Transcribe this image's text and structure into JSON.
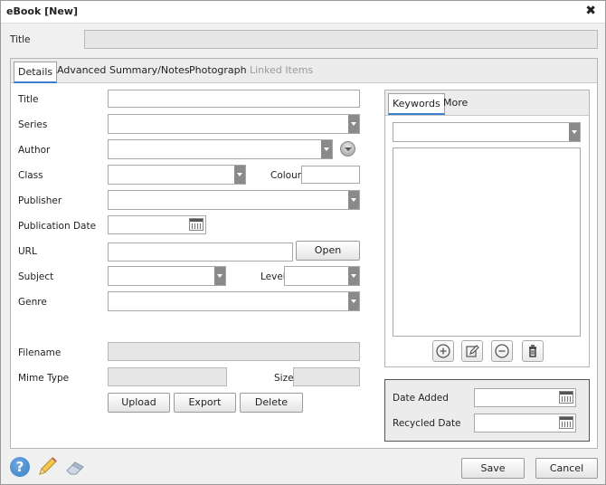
{
  "window": {
    "title": "eBook [New]",
    "close_glyph": "✖"
  },
  "header": {
    "title_label": "Title",
    "title_value": ""
  },
  "tabs": [
    {
      "label": "Details",
      "active": true
    },
    {
      "label": "Advanced"
    },
    {
      "label": "Summary/Notes"
    },
    {
      "label": "Photograph"
    },
    {
      "label": "Linked Items",
      "disabled": true
    }
  ],
  "details": {
    "title_label": "Title",
    "series_label": "Series",
    "author_label": "Author",
    "class_label": "Class",
    "colour_label": "Colour",
    "publisher_label": "Publisher",
    "publication_date_label": "Publication Date",
    "url_label": "URL",
    "open_button": "Open",
    "subject_label": "Subject",
    "level_label": "Level",
    "genre_label": "Genre",
    "filename_label": "Filename",
    "mime_type_label": "Mime Type",
    "size_label": "Size",
    "upload_button": "Upload",
    "export_button": "Export",
    "delete_button": "Delete"
  },
  "side_tabs": [
    {
      "label": "Keywords",
      "active": true
    },
    {
      "label": "More"
    }
  ],
  "keywords_toolbar": {
    "icons": [
      "add-icon",
      "edit-icon",
      "remove-icon",
      "trash-icon"
    ]
  },
  "dates": {
    "date_added_label": "Date Added",
    "recycled_date_label": "Recycled Date"
  },
  "footer": {
    "save_button": "Save",
    "cancel_button": "Cancel",
    "icons": [
      "help-icon",
      "pencil-icon",
      "eraser-icon"
    ]
  },
  "colors": {
    "accent": "#3c7fd0",
    "help_blue": "#3b7fc4"
  }
}
